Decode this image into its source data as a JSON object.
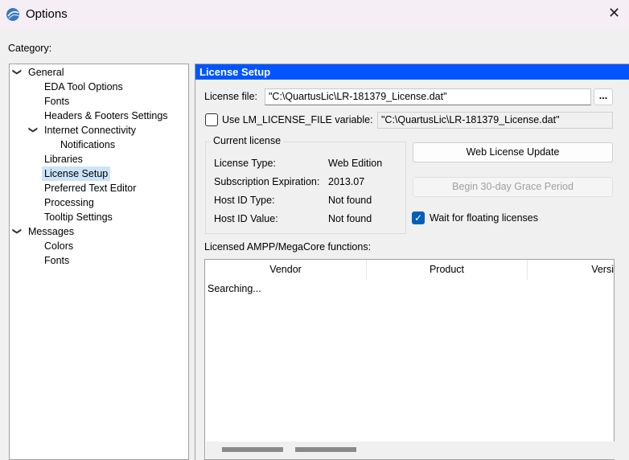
{
  "window": {
    "title": "Options",
    "icon": "quartus-globe-icon"
  },
  "category_label": "Category:",
  "tree": [
    {
      "label": "General",
      "level": 0,
      "expanded": true
    },
    {
      "label": "EDA Tool Options",
      "level": 1
    },
    {
      "label": "Fonts",
      "level": 1
    },
    {
      "label": "Headers & Footers Settings",
      "level": 1
    },
    {
      "label": "Internet Connectivity",
      "level": 1,
      "expanded": true
    },
    {
      "label": "Notifications",
      "level": 2
    },
    {
      "label": "Libraries",
      "level": 1
    },
    {
      "label": "License Setup",
      "level": 1,
      "selected": true
    },
    {
      "label": "Preferred Text Editor",
      "level": 1
    },
    {
      "label": "Processing",
      "level": 1
    },
    {
      "label": "Tooltip Settings",
      "level": 1
    },
    {
      "label": "Messages",
      "level": 0,
      "expanded": true
    },
    {
      "label": "Colors",
      "level": 1
    },
    {
      "label": "Fonts",
      "level": 1
    }
  ],
  "panel": {
    "title": "License Setup",
    "header_color": "#0055ff",
    "license_file_label": "License file:",
    "license_file_value": "\"C:\\QuartusLic\\LR-181379_License.dat\"",
    "browse_label": "...",
    "lm_checkbox_label": "Use LM_LICENSE_FILE variable:",
    "lm_checked": false,
    "lm_value": "\"C:\\QuartusLic\\LR-181379_License.dat\"",
    "current_license": {
      "title": "Current license",
      "rows": [
        {
          "label": "License Type:",
          "value": "Web Edition"
        },
        {
          "label": "Subscription Expiration:",
          "value": "2013.07"
        },
        {
          "label": "Host ID Type:",
          "value": "Not found"
        },
        {
          "label": "Host ID Value:",
          "value": "Not found"
        }
      ]
    },
    "web_update_label": "Web License Update",
    "grace_label": "Begin 30-day Grace Period",
    "wait_label": "Wait for floating licenses",
    "wait_checked": true,
    "functions_label": "Licensed AMPP/MegaCore functions:",
    "columns": [
      "Vendor",
      "Product",
      "Versi"
    ],
    "status": "Searching..."
  }
}
